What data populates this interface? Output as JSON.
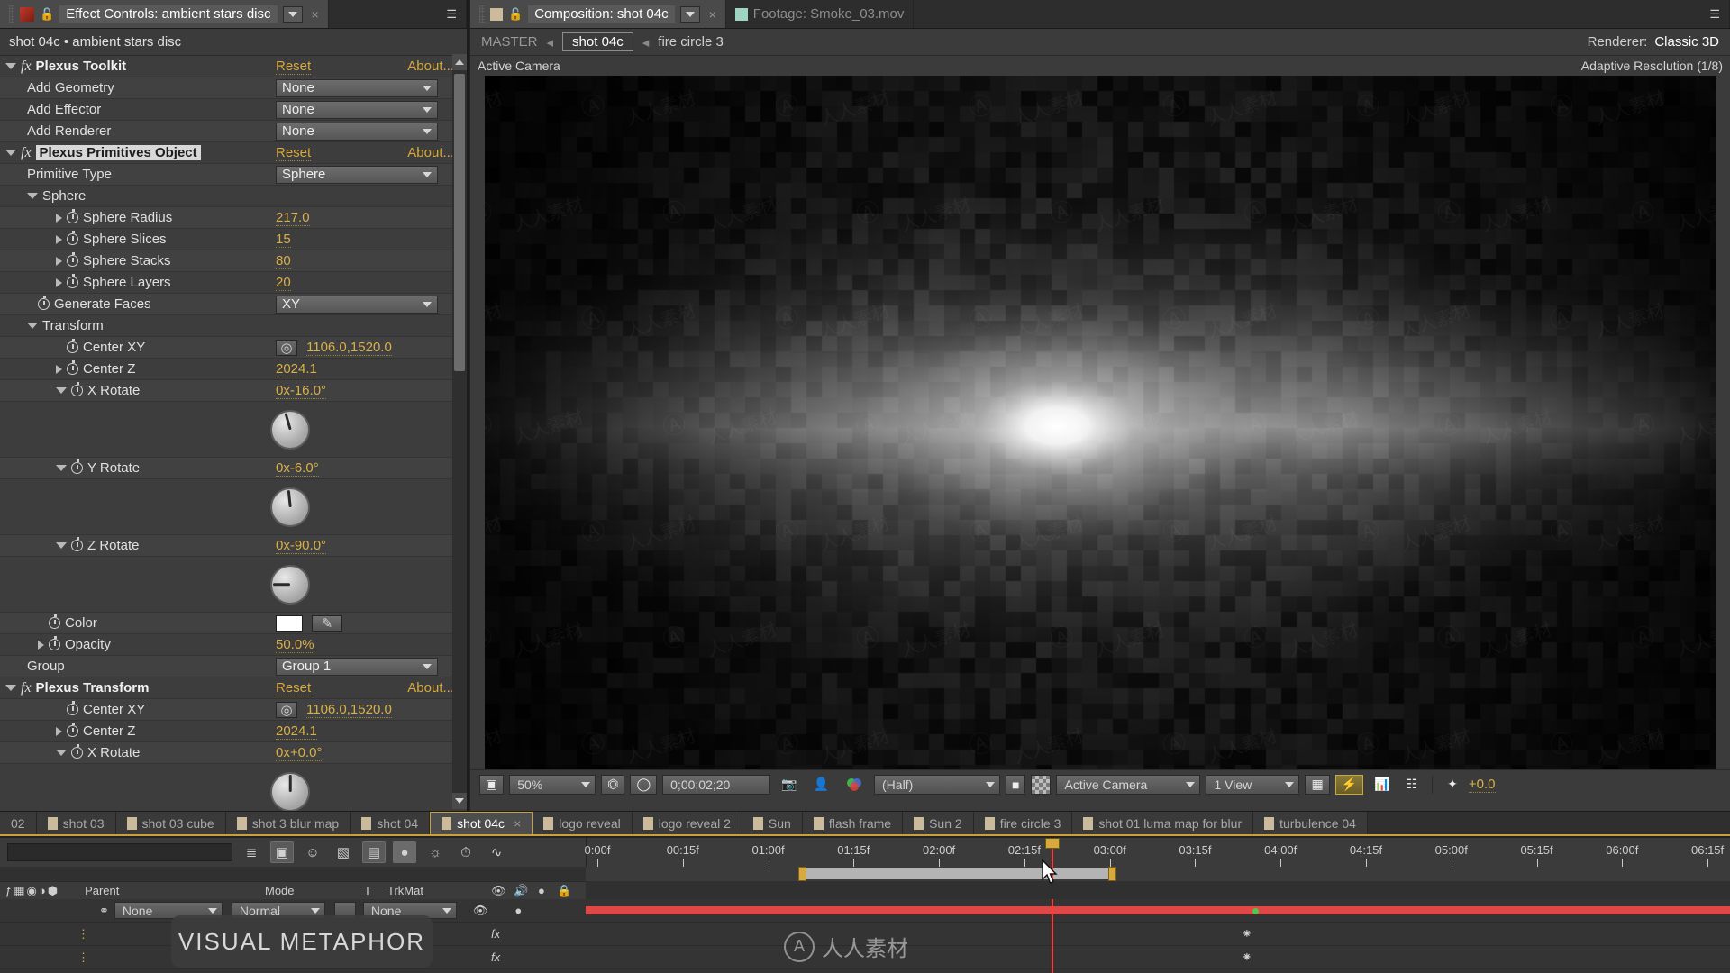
{
  "effect_controls": {
    "tab_title": "Effect Controls: ambient stars disc",
    "tab_close": "×",
    "header": "shot 04c • ambient stars disc",
    "reset_label": "Reset",
    "about_label": "About...",
    "effects": [
      {
        "name": "Plexus Toolkit",
        "params": [
          {
            "label": "Add Geometry",
            "type": "dropdown",
            "value": "None"
          },
          {
            "label": "Add Effector",
            "type": "dropdown",
            "value": "None"
          },
          {
            "label": "Add Renderer",
            "type": "dropdown",
            "value": "None"
          }
        ]
      },
      {
        "name": "Plexus Primitives Object",
        "selected": true,
        "params": [
          {
            "label": "Primitive Type",
            "type": "dropdown",
            "value": "Sphere"
          },
          {
            "label": "Sphere",
            "type": "group"
          },
          {
            "label": "Sphere Radius",
            "type": "number",
            "value": "217.0"
          },
          {
            "label": "Sphere Slices",
            "type": "number",
            "value": "15"
          },
          {
            "label": "Sphere Stacks",
            "type": "number",
            "value": "80"
          },
          {
            "label": "Sphere Layers",
            "type": "number",
            "value": "20"
          },
          {
            "label": "Generate Faces",
            "type": "dropdown",
            "value": "XY"
          },
          {
            "label": "Transform",
            "type": "group"
          },
          {
            "label": "Center XY",
            "type": "point",
            "value": "1106.0,1520.0"
          },
          {
            "label": "Center Z",
            "type": "number",
            "value": "2024.1"
          },
          {
            "label": "X Rotate",
            "type": "angle",
            "value": "0x-16.0°",
            "degrees": -16
          },
          {
            "label": "Y Rotate",
            "type": "angle",
            "value": "0x-6.0°",
            "degrees": -6
          },
          {
            "label": "Z Rotate",
            "type": "angle",
            "value": "0x-90.0°",
            "degrees": -90
          },
          {
            "label": "Color",
            "type": "color",
            "value": "#ffffff"
          },
          {
            "label": "Opacity",
            "type": "number",
            "value": "50.0%"
          },
          {
            "label": "Group",
            "type": "dropdown",
            "value": "Group 1"
          }
        ]
      },
      {
        "name": "Plexus Transform",
        "params": [
          {
            "label": "Center XY",
            "type": "point",
            "value": "1106.0,1520.0"
          },
          {
            "label": "Center Z",
            "type": "number",
            "value": "2024.1"
          },
          {
            "label": "X Rotate",
            "type": "angle",
            "value": "0x+0.0°",
            "degrees": 0
          }
        ]
      }
    ]
  },
  "composition": {
    "tab_title": "Composition: shot 04c",
    "footage_tab": "Footage: Smoke_03.mov",
    "breadcrumb": {
      "master": "MASTER",
      "comp": "shot 04c",
      "layer": "fire circle 3"
    },
    "renderer_label": "Renderer:",
    "renderer_value": "Classic 3D",
    "view_label": "Active Camera",
    "resolution_note": "Adaptive Resolution (1/8)",
    "toolbar": {
      "zoom": "50%",
      "timecode": "0;00;02;20",
      "resolution": "(Half)",
      "camera": "Active Camera",
      "views": "1 View",
      "exposure": "+0.0"
    }
  },
  "comp_tabs": [
    {
      "label": "02",
      "active": false,
      "noicon": true
    },
    {
      "label": "shot 03",
      "active": false
    },
    {
      "label": "shot 03 cube",
      "active": false
    },
    {
      "label": "shot 3 blur map",
      "active": false
    },
    {
      "label": "shot 04",
      "active": false
    },
    {
      "label": "shot 04c",
      "active": true
    },
    {
      "label": "logo reveal",
      "active": false
    },
    {
      "label": "logo reveal 2",
      "active": false
    },
    {
      "label": "Sun",
      "active": false
    },
    {
      "label": "flash frame",
      "active": false
    },
    {
      "label": "Sun 2",
      "active": false
    },
    {
      "label": "fire circle 3",
      "active": false
    },
    {
      "label": "shot 01 luma map for blur",
      "active": false
    },
    {
      "label": "turbulence 04",
      "active": false
    }
  ],
  "timeline": {
    "search_placeholder": "",
    "columns": {
      "parent": "Parent",
      "mode": "Mode",
      "t": "T",
      "trkmat": "TrkMat"
    },
    "row_values": {
      "parent": "None",
      "mode": "Normal",
      "trkmat": "None"
    },
    "ruler_labels": [
      "0:00f",
      "00:15f",
      "01:00f",
      "01:15f",
      "02:00f",
      "02:15f",
      "03:00f",
      "03:15f",
      "04:00f",
      "04:15f",
      "05:00f",
      "05:15f",
      "06:00f",
      "06:15f"
    ],
    "playhead_time": "02:15f"
  },
  "overlay": {
    "metaphor_text": "VISUAL METAPHOR",
    "watermark_cn": "人人素材",
    "watermark_mark": "A"
  },
  "colors": {
    "accent": "#d8a93c",
    "number": "#d8b04a",
    "panel": "#3b3b3b",
    "cti": "#ff3a3a"
  }
}
